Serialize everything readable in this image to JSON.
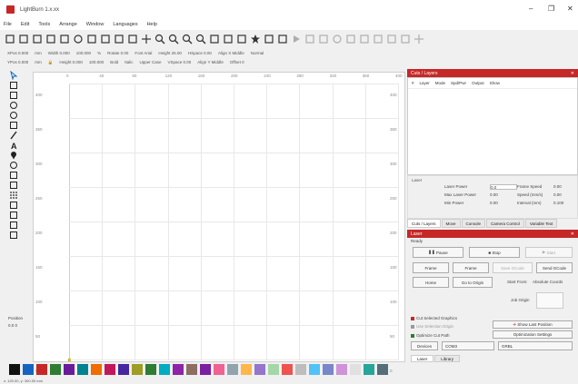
{
  "window": {
    "title": "LightBurn 1.x.xx",
    "controls": [
      "–",
      "❐",
      "✕"
    ]
  },
  "menu": [
    "File",
    "Edit",
    "Tools",
    "Arrange",
    "Window",
    "Languages",
    "Help"
  ],
  "toolbar_icons": [
    "new-file-icon",
    "open-file-icon",
    "save-icon",
    "save-as-icon",
    "import-icon",
    "settings-icon",
    "copy-icon",
    "cut-icon",
    "paste-icon",
    "delete-icon",
    "move-icon",
    "zoom-in-icon",
    "zoom-out-icon",
    "zoom-frame-icon",
    "zoom-page-icon",
    "camera-icon",
    "monitor-icon",
    "wrench-icon",
    "star-icon",
    "weld-icon",
    "boolean-icon",
    "play-icon",
    "offset-icon",
    "mirror-icon",
    "circle-grid-icon",
    "group-icon",
    "ungroup-icon",
    "align-icon",
    "array-icon",
    "distribute-icon",
    "plus-icon"
  ],
  "options_row1": {
    "xpos_label": "XPos 0.000",
    "ypos_label": "YPos 0.000",
    "mm": "mm",
    "width_label": "Width 0.000",
    "height_label": "Height 0.000",
    "mm2": "mm",
    "pct_w": "100.000",
    "pct_h": "100.000",
    "pct": "%",
    "rotate_label": "Rotate 0.00",
    "font_label": "Font Arial",
    "height2_label": "Height 25.00",
    "hspace_label": "HSpace 0.00",
    "align_x": "Align X Middle",
    "normal": "Normal",
    "bold": "Bold",
    "italic": "Italic",
    "upper_case": "Upper Case",
    "vspace_label": "VSpace 0.00",
    "align_y": "Align Y Middle",
    "offset": "Offset 0"
  },
  "left_tools": [
    "select-icon",
    "edit-nodes-icon",
    "rectangle-icon",
    "circle-icon",
    "ellipse-icon",
    "polygon-icon",
    "pen-icon",
    "text-icon",
    "position-laser-icon",
    "measure-icon",
    "cut-shapes-icon",
    "tabs-icon",
    "grid-icon",
    "fill-icon",
    "copy-along-path-icon",
    "trace-icon",
    "ungroup-icon"
  ],
  "left_labels": {
    "position": "Position",
    "pos_value": "0.0 0"
  },
  "ruler": {
    "top": [
      "0",
      "40",
      "80",
      "120",
      "160",
      "200",
      "240",
      "280",
      "320",
      "360",
      "400"
    ],
    "left": [
      "400",
      "350",
      "300",
      "250",
      "200",
      "150",
      "100",
      "50",
      "0"
    ]
  },
  "cuts_layers": {
    "title": "Cuts / Layers",
    "columns": [
      "#",
      "Layer",
      "Mode",
      "Spd/Pwr",
      "Output",
      "Show"
    ]
  },
  "laser_section": {
    "title": "Laser",
    "fields": [
      {
        "label": "Laser Power",
        "value": "0.0"
      },
      {
        "label": "Max Laser Power",
        "value": "0.00"
      },
      {
        "label": "Min Power",
        "value": "0.00"
      },
      {
        "label": "Frame Speed",
        "value": "0.00"
      },
      {
        "label": "Speed (mm/s)",
        "value": "0.00"
      },
      {
        "label": "Interval (mm)",
        "value": "0.100"
      }
    ]
  },
  "panel_tabs": [
    "Cuts / Layers",
    "Move",
    "Console",
    "Camera Control",
    "Variable Text"
  ],
  "laser_panel": {
    "title": "Laser",
    "ready": "Ready",
    "pause": "Pause",
    "stop": "Stop",
    "start": "Start",
    "frame": "Frame",
    "frame2": "Frame",
    "save_gcode": "Save GCode",
    "send_gcode": "Send GCode",
    "home": "Home",
    "go_to_origin": "Go to Origin",
    "start_from": "Start From:",
    "start_from_value": "Absolute Coords",
    "job_origin": "Job Origin",
    "cut_selected": "Cut Selected Graphics",
    "use_selection_origin": "Use Selection Origin",
    "optimize": "Optimize Cut Path",
    "show_last_position": "Show Last Position",
    "optimization_settings": "Optimization Settings",
    "devices": "Devices",
    "com_port": "COM3",
    "machine": "GRBL"
  },
  "bottom_tabs": [
    "Laser",
    "Library"
  ],
  "palette": [
    "#111111",
    "#1565c0",
    "#c62828",
    "#2e7d32",
    "#6a1b9a",
    "#00838f",
    "#ef6c00",
    "#c2185b",
    "#4527a0",
    "#9e9d24",
    "#2e7d32",
    "#00acc1",
    "#8e24aa",
    "#8d6e63",
    "#7b1fa2",
    "#f06292",
    "#90a4ae",
    "#ffb74d",
    "#9575cd",
    "#a5d6a7",
    "#ef5350",
    "#bdbdbd",
    "#4fc3f7",
    "#7986cb",
    "#ce93d8",
    "#e0e0e0",
    "#26a69a",
    "#546e7a"
  ],
  "status_text": "x: 120.00, y: 300.00 mm"
}
